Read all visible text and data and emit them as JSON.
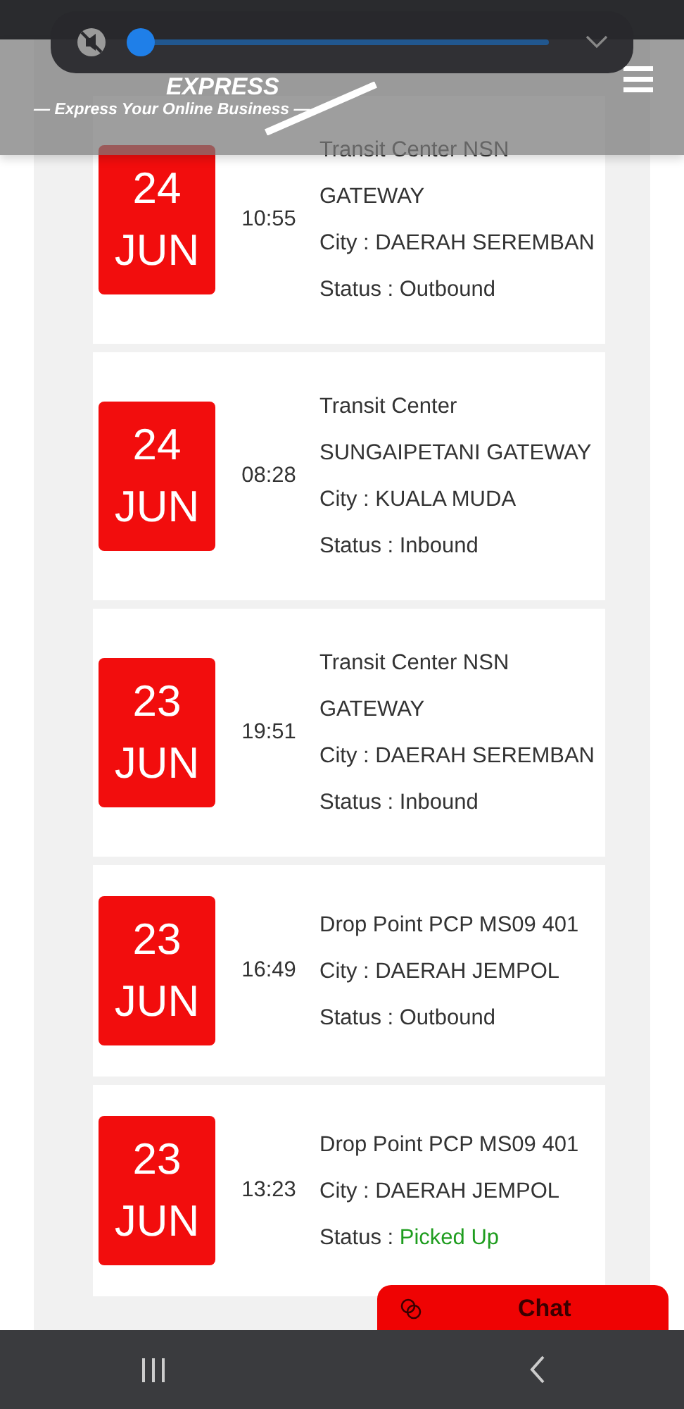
{
  "header": {
    "brand": "EXPRESS",
    "tagline": "— Express Your Online Business —"
  },
  "media_player": {
    "level": 0
  },
  "events": [
    {
      "day": "24",
      "month": "JUN",
      "time": "10:55",
      "lines": [
        "Transit Center NSN GATEWAY",
        "City : DAERAH SEREMBAN"
      ],
      "status_label": "Status : ",
      "status": "Outbound",
      "color": "#333333"
    },
    {
      "day": "24",
      "month": "JUN",
      "time": "08:28",
      "lines": [
        "Transit Center SUNGAIPETANI GATEWAY",
        "City : KUALA MUDA"
      ],
      "status_label": "Status : ",
      "status": "Inbound",
      "color": "#333333"
    },
    {
      "day": "23",
      "month": "JUN",
      "time": "19:51",
      "lines": [
        "Transit Center NSN GATEWAY",
        "City : DAERAH SEREMBAN"
      ],
      "status_label": "Status : ",
      "status": "Inbound",
      "color": "#333333"
    },
    {
      "day": "23",
      "month": "JUN",
      "time": "16:49",
      "lines": [
        "Drop Point PCP MS09 401",
        "City : DAERAH JEMPOL"
      ],
      "status_label": "Status : ",
      "status": "Outbound",
      "color": "#333333"
    },
    {
      "day": "23",
      "month": "JUN",
      "time": "13:23",
      "lines": [
        "Drop Point PCP MS09 401",
        "City : DAERAH JEMPOL"
      ],
      "status_label": "Status : ",
      "status": "Picked Up",
      "color": "#1f9d1f"
    }
  ],
  "chat_button": {
    "label": "Chat"
  }
}
